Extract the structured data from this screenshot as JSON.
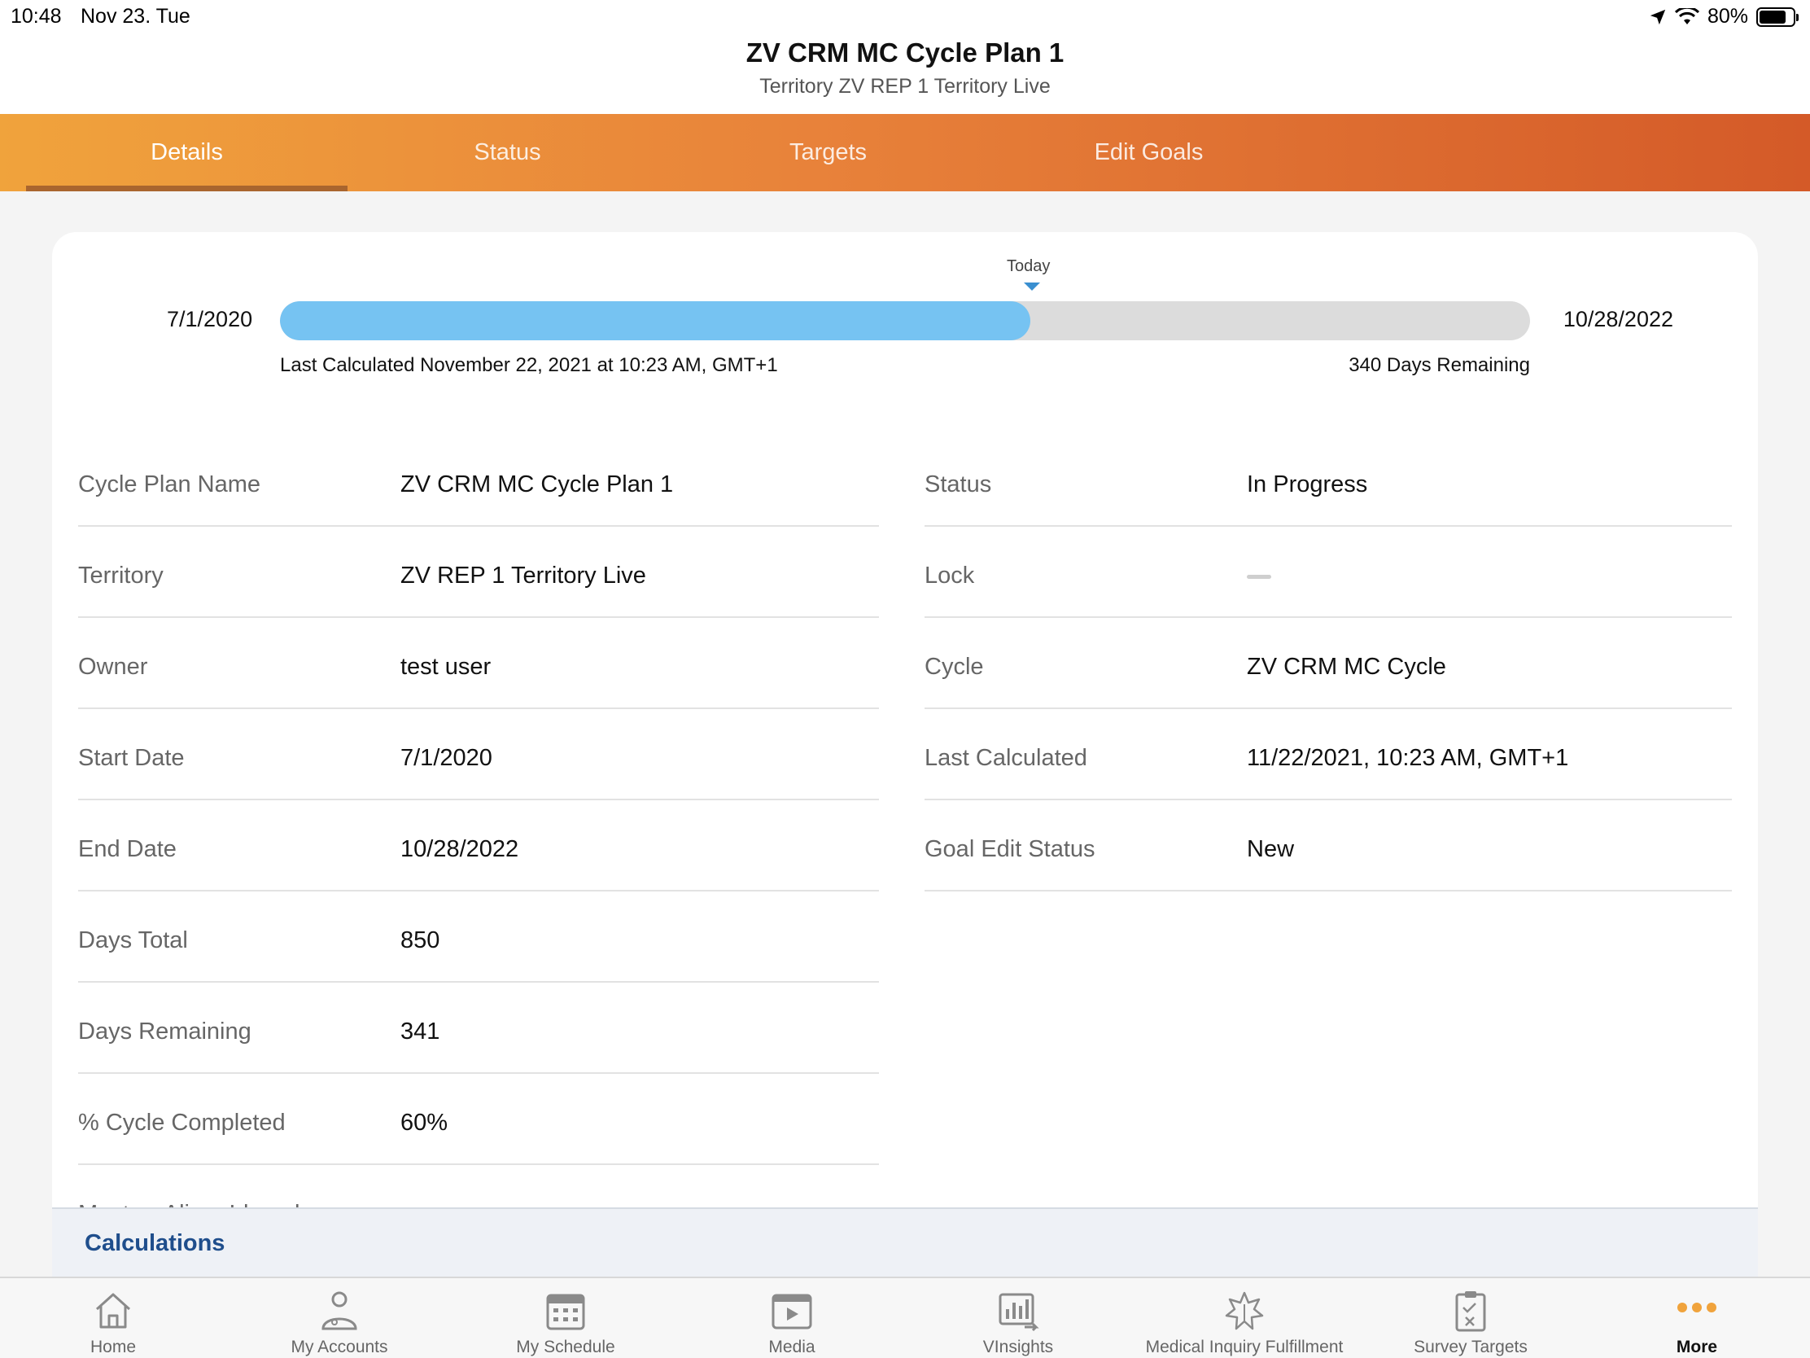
{
  "status_bar": {
    "time": "10:48",
    "date": "Nov 23. Tue",
    "battery": "80%",
    "battery_level": 0.8
  },
  "header": {
    "title": "ZV CRM MC Cycle Plan 1",
    "subtitle": "Territory ZV REP 1 Territory Live"
  },
  "tabs": [
    {
      "label": "Details",
      "active": true
    },
    {
      "label": "Status",
      "active": false
    },
    {
      "label": "Targets",
      "active": false
    },
    {
      "label": "Edit Goals",
      "active": false
    }
  ],
  "timeline": {
    "start": "7/1/2020",
    "end": "10/28/2022",
    "today_label": "Today",
    "progress_fraction": 0.6,
    "last_calculated": "Last Calculated November 22, 2021 at 10:23 AM, GMT+1",
    "remaining": "340 Days Remaining"
  },
  "details_left": [
    {
      "label": "Cycle Plan Name",
      "value": "ZV CRM MC Cycle Plan 1"
    },
    {
      "label": "Territory",
      "value": "ZV REP 1 Territory Live"
    },
    {
      "label": "Owner",
      "value": "test user"
    },
    {
      "label": "Start Date",
      "value": "7/1/2020"
    },
    {
      "label": "End Date",
      "value": "10/28/2022"
    },
    {
      "label": "Days Total",
      "value": "850"
    },
    {
      "label": "Days Remaining",
      "value": "341"
    },
    {
      "label": "% Cycle Completed",
      "value": "60%"
    },
    {
      "label": "Master_Align_Id_vod",
      "value": ""
    }
  ],
  "details_right": [
    {
      "label": "Status",
      "value": "In Progress"
    },
    {
      "label": "Lock",
      "value": ""
    },
    {
      "label": "Cycle",
      "value": "ZV CRM MC Cycle"
    },
    {
      "label": "Last Calculated",
      "value": "11/22/2021, 10:23 AM, GMT+1"
    },
    {
      "label": "Goal Edit Status",
      "value": "New"
    }
  ],
  "calculations": {
    "title": "Calculations"
  },
  "bottom_nav": [
    {
      "label": "Home",
      "icon": "home-icon"
    },
    {
      "label": "My Accounts",
      "icon": "person-icon"
    },
    {
      "label": "My Schedule",
      "icon": "calendar-icon"
    },
    {
      "label": "Media",
      "icon": "media-icon"
    },
    {
      "label": "VInsights",
      "icon": "chart-icon"
    },
    {
      "label": "Medical Inquiry Fulfillment",
      "icon": "medical-icon"
    },
    {
      "label": "Survey Targets",
      "icon": "clipboard-icon"
    },
    {
      "label": "More",
      "icon": "more-icon",
      "active": true
    }
  ],
  "colors": {
    "tab_gradient_start": "#f0a33c",
    "tab_gradient_end": "#d45a28",
    "progress_fill": "#76c3f2",
    "calc_title": "#1f4e8c"
  }
}
